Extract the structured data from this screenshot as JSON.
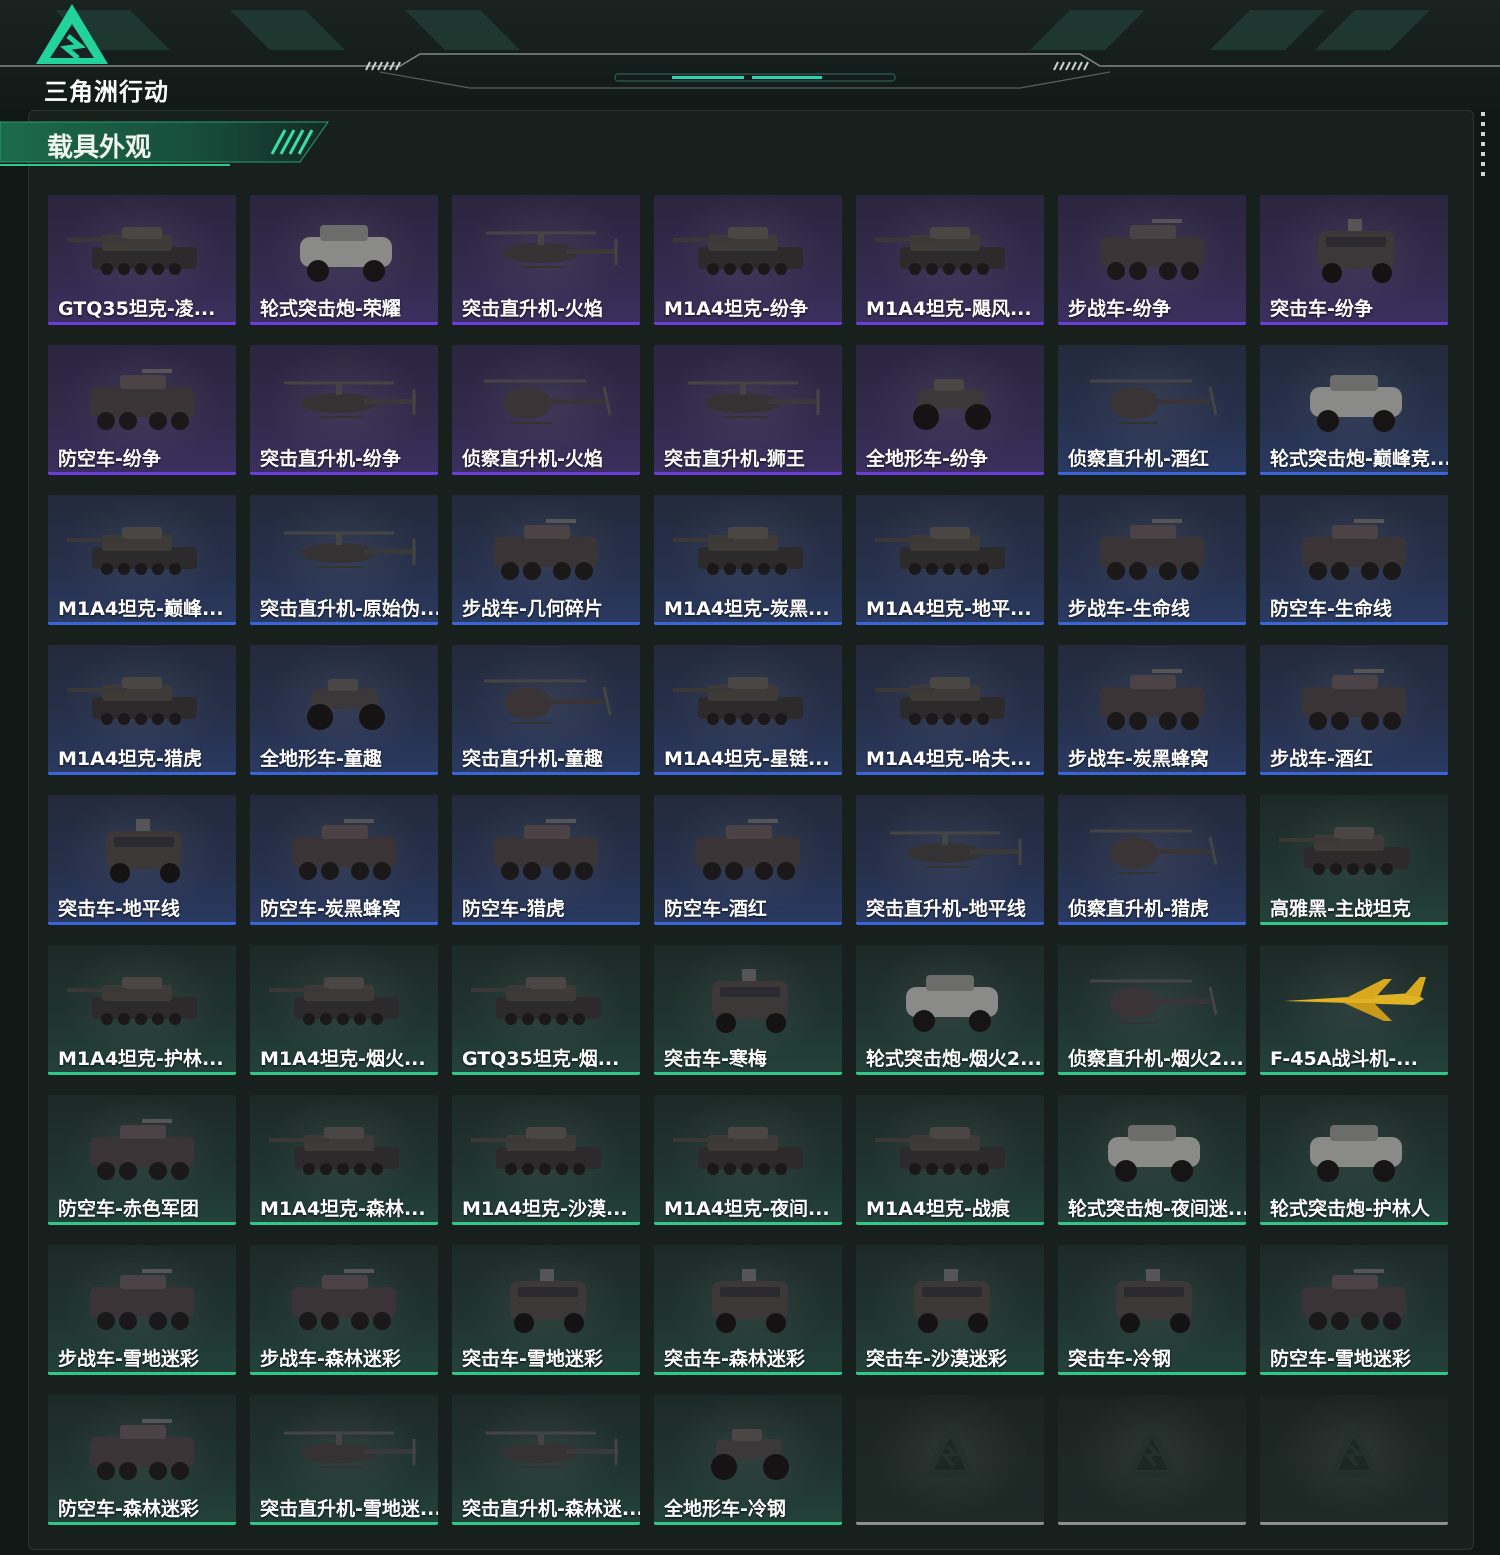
{
  "header": {
    "logo_text": "三角洲行动"
  },
  "section": {
    "title": "载具外观"
  },
  "colors": {
    "purple": "#6a3cd9",
    "blue": "#3a64d8",
    "green": "#2fc88a",
    "accent": "#24d49a"
  },
  "skins": [
    {
      "name": "GTQ35坦克-凌...",
      "rarity": "purple",
      "vehicle": "tank-icon"
    },
    {
      "name": "轮式突击炮-荣耀",
      "rarity": "purple",
      "vehicle": "armored-car-icon"
    },
    {
      "name": "突击直升机-火焰",
      "rarity": "purple",
      "vehicle": "helicopter-icon"
    },
    {
      "name": "M1A4坦克-纷争",
      "rarity": "purple",
      "vehicle": "tank-icon"
    },
    {
      "name": "M1A4坦克-飓风...",
      "rarity": "purple",
      "vehicle": "tank-icon"
    },
    {
      "name": "步战车-纷争",
      "rarity": "purple",
      "vehicle": "ifv-icon"
    },
    {
      "name": "突击车-纷争",
      "rarity": "purple",
      "vehicle": "assault-car-icon"
    },
    {
      "name": "防空车-纷争",
      "rarity": "purple",
      "vehicle": "ifv-icon"
    },
    {
      "name": "突击直升机-纷争",
      "rarity": "purple",
      "vehicle": "helicopter-icon"
    },
    {
      "name": "侦察直升机-火焰",
      "rarity": "purple",
      "vehicle": "scout-helicopter-icon"
    },
    {
      "name": "突击直升机-狮王",
      "rarity": "purple",
      "vehicle": "helicopter-icon"
    },
    {
      "name": "全地形车-纷争",
      "rarity": "purple",
      "vehicle": "atv-icon"
    },
    {
      "name": "侦察直升机-酒红",
      "rarity": "blue",
      "vehicle": "scout-helicopter-icon"
    },
    {
      "name": "轮式突击炮-巅峰竞...",
      "rarity": "blue",
      "vehicle": "armored-car-icon"
    },
    {
      "name": "M1A4坦克-巅峰...",
      "rarity": "blue",
      "vehicle": "tank-icon"
    },
    {
      "name": "突击直升机-原始伪...",
      "rarity": "blue",
      "vehicle": "helicopter-icon"
    },
    {
      "name": "步战车-几何碎片",
      "rarity": "blue",
      "vehicle": "ifv-icon"
    },
    {
      "name": "M1A4坦克-炭黑...",
      "rarity": "blue",
      "vehicle": "tank-icon"
    },
    {
      "name": "M1A4坦克-地平...",
      "rarity": "blue",
      "vehicle": "tank-icon"
    },
    {
      "name": "步战车-生命线",
      "rarity": "blue",
      "vehicle": "ifv-icon"
    },
    {
      "name": "防空车-生命线",
      "rarity": "blue",
      "vehicle": "ifv-icon"
    },
    {
      "name": "M1A4坦克-猎虎",
      "rarity": "blue",
      "vehicle": "tank-icon"
    },
    {
      "name": "全地形车-童趣",
      "rarity": "blue",
      "vehicle": "atv-icon"
    },
    {
      "name": "突击直升机-童趣",
      "rarity": "blue",
      "vehicle": "scout-helicopter-icon"
    },
    {
      "name": "M1A4坦克-星链...",
      "rarity": "blue",
      "vehicle": "tank-icon"
    },
    {
      "name": "M1A4坦克-哈夫...",
      "rarity": "blue",
      "vehicle": "tank-icon"
    },
    {
      "name": "步战车-炭黑蜂窝",
      "rarity": "blue",
      "vehicle": "ifv-icon"
    },
    {
      "name": "步战车-酒红",
      "rarity": "blue",
      "vehicle": "ifv-icon"
    },
    {
      "name": "突击车-地平线",
      "rarity": "blue",
      "vehicle": "assault-car-icon"
    },
    {
      "name": "防空车-炭黑蜂窝",
      "rarity": "blue",
      "vehicle": "ifv-icon"
    },
    {
      "name": "防空车-猎虎",
      "rarity": "blue",
      "vehicle": "ifv-icon"
    },
    {
      "name": "防空车-酒红",
      "rarity": "blue",
      "vehicle": "ifv-icon"
    },
    {
      "name": "突击直升机-地平线",
      "rarity": "blue",
      "vehicle": "helicopter-icon"
    },
    {
      "name": "侦察直升机-猎虎",
      "rarity": "blue",
      "vehicle": "scout-helicopter-icon"
    },
    {
      "name": "高雅黑-主战坦克",
      "rarity": "green",
      "vehicle": "tank-icon"
    },
    {
      "name": "M1A4坦克-护林...",
      "rarity": "green",
      "vehicle": "tank-icon"
    },
    {
      "name": "M1A4坦克-烟火...",
      "rarity": "green",
      "vehicle": "tank-icon"
    },
    {
      "name": "GTQ35坦克-烟...",
      "rarity": "green",
      "vehicle": "tank-icon"
    },
    {
      "name": "突击车-寒梅",
      "rarity": "green",
      "vehicle": "assault-car-icon"
    },
    {
      "name": "轮式突击炮-烟火2...",
      "rarity": "green",
      "vehicle": "armored-car-icon"
    },
    {
      "name": "侦察直升机-烟火2...",
      "rarity": "green",
      "vehicle": "scout-helicopter-icon"
    },
    {
      "name": "F-45A战斗机-...",
      "rarity": "green",
      "vehicle": "jet-icon"
    },
    {
      "name": "防空车-赤色军团",
      "rarity": "green",
      "vehicle": "ifv-icon"
    },
    {
      "name": "M1A4坦克-森林...",
      "rarity": "green",
      "vehicle": "tank-icon"
    },
    {
      "name": "M1A4坦克-沙漠...",
      "rarity": "green",
      "vehicle": "tank-icon"
    },
    {
      "name": "M1A4坦克-夜间...",
      "rarity": "green",
      "vehicle": "tank-icon"
    },
    {
      "name": "M1A4坦克-战痕",
      "rarity": "green",
      "vehicle": "tank-icon"
    },
    {
      "name": "轮式突击炮-夜间迷...",
      "rarity": "green",
      "vehicle": "armored-car-icon"
    },
    {
      "name": "轮式突击炮-护林人",
      "rarity": "green",
      "vehicle": "armored-car-icon"
    },
    {
      "name": "步战车-雪地迷彩",
      "rarity": "green",
      "vehicle": "ifv-icon"
    },
    {
      "name": "步战车-森林迷彩",
      "rarity": "green",
      "vehicle": "ifv-icon"
    },
    {
      "name": "突击车-雪地迷彩",
      "rarity": "green",
      "vehicle": "assault-car-icon"
    },
    {
      "name": "突击车-森林迷彩",
      "rarity": "green",
      "vehicle": "assault-car-icon"
    },
    {
      "name": "突击车-沙漠迷彩",
      "rarity": "green",
      "vehicle": "assault-car-icon"
    },
    {
      "name": "突击车-冷钢",
      "rarity": "green",
      "vehicle": "assault-car-icon"
    },
    {
      "name": "防空车-雪地迷彩",
      "rarity": "green",
      "vehicle": "ifv-icon"
    },
    {
      "name": "防空车-森林迷彩",
      "rarity": "green",
      "vehicle": "ifv-icon"
    },
    {
      "name": "突击直升机-雪地迷...",
      "rarity": "green",
      "vehicle": "helicopter-icon"
    },
    {
      "name": "突击直升机-森林迷...",
      "rarity": "green",
      "vehicle": "helicopter-icon"
    },
    {
      "name": "全地形车-冷钢",
      "rarity": "green",
      "vehicle": "atv-icon"
    },
    {
      "name": "",
      "rarity": "empty",
      "vehicle": "empty-slot-logo-icon"
    },
    {
      "name": "",
      "rarity": "empty",
      "vehicle": "empty-slot-logo-icon"
    },
    {
      "name": "",
      "rarity": "empty",
      "vehicle": "empty-slot-logo-icon"
    }
  ]
}
